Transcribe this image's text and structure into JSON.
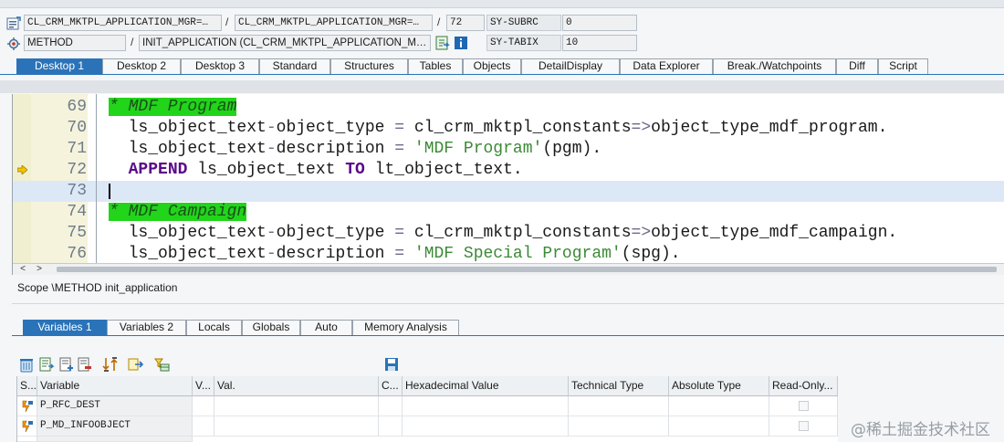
{
  "header": {
    "program_1": "CL_CRM_MKTPL_APPLICATION_MGR=…",
    "program_2": "CL_CRM_MKTPL_APPLICATION_MGR=…",
    "line_number": "72",
    "sy_subrc_label": "SY-SUBRC",
    "sy_subrc_value": "0",
    "event_type": "METHOD",
    "event_name": "INIT_APPLICATION (CL_CRM_MKTPL_APPLICATION_M…",
    "sy_tabix_label": "SY-TABIX",
    "sy_tabix_value": "10",
    "slash": "/"
  },
  "desktop_tabs": [
    {
      "label": "Desktop 1",
      "active": true
    },
    {
      "label": "Desktop 2"
    },
    {
      "label": "Desktop 3"
    },
    {
      "label": "Standard"
    },
    {
      "label": "Structures"
    },
    {
      "label": "Tables"
    },
    {
      "label": "Objects"
    },
    {
      "label": "DetailDisplay"
    },
    {
      "label": "Data Explorer"
    },
    {
      "label": "Break./Watchpoints"
    },
    {
      "label": "Diff"
    },
    {
      "label": "Script"
    }
  ],
  "code_lines": [
    {
      "no": "69",
      "text": "* MDF Program"
    },
    {
      "no": "70",
      "text": "  ls_object_text-object_type = cl_crm_mktpl_constants=>object_type_mdf_program."
    },
    {
      "no": "71",
      "text": "  ls_object_text-description = 'MDF Program'(pgm)."
    },
    {
      "no": "72",
      "text": "  APPEND ls_object_text TO lt_object_text."
    },
    {
      "no": "73",
      "text": ""
    },
    {
      "no": "74",
      "text": "* MDF Campaign"
    },
    {
      "no": "75",
      "text": "  ls_object_text-object_type = cl_crm_mktpl_constants=>object_type_mdf_campaign."
    },
    {
      "no": "76",
      "text": "  ls_object_text-description = 'MDF Special Program'(spg)."
    }
  ],
  "scroll": {
    "left": "<",
    "right": ">"
  },
  "scope_text": "Scope \\METHOD init_application",
  "variable_tabs": [
    {
      "label": "Variables 1",
      "active": true
    },
    {
      "label": "Variables 2"
    },
    {
      "label": "Locals"
    },
    {
      "label": "Globals"
    },
    {
      "label": "Auto"
    },
    {
      "label": "Memory Analysis"
    }
  ],
  "table": {
    "columns": [
      "S...",
      "Variable",
      "V...",
      "Val.",
      "C...",
      "Hexadecimal Value",
      "Technical Type",
      "Absolute Type",
      "Read-Only..."
    ],
    "rows": [
      {
        "variable": "P_RFC_DEST"
      },
      {
        "variable": "P_MD_INFOOBJECT"
      }
    ]
  },
  "watermark": "@稀土掘金技术社区",
  "colors": {
    "accent": "#2a73b8",
    "comment_bg": "#22d41a",
    "keyword": "#5a0a8a",
    "string": "#3b8a35"
  }
}
